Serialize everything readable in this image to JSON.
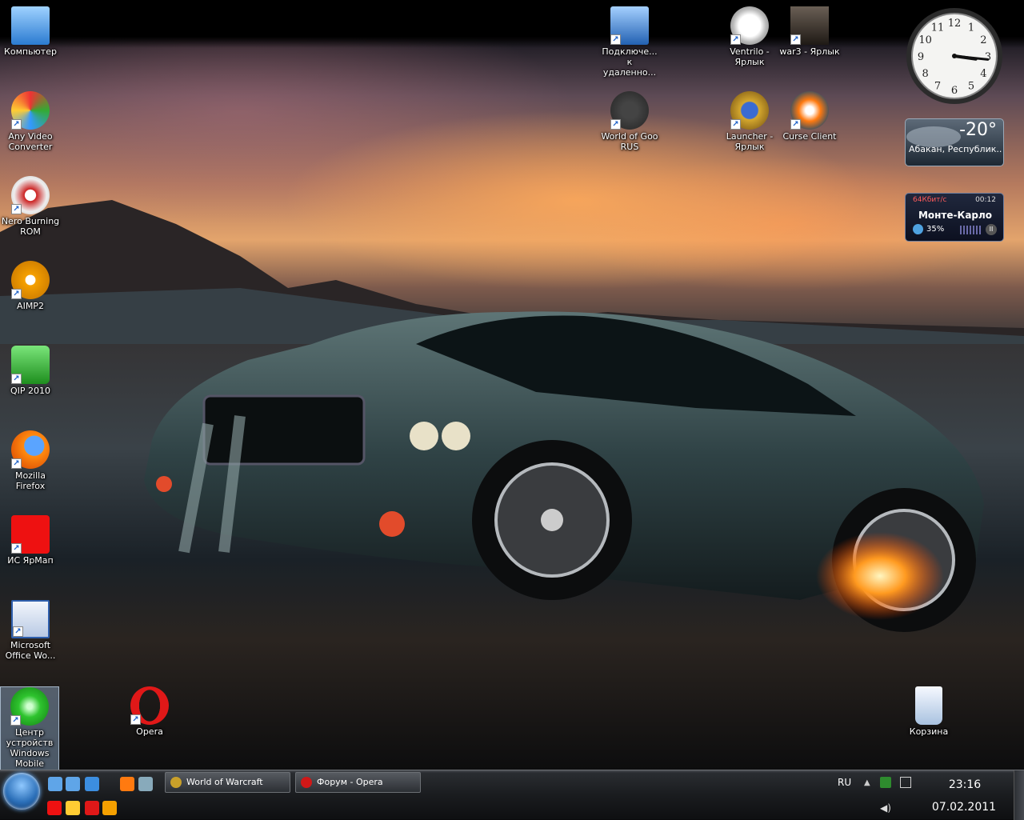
{
  "desktop": {
    "icons": [
      {
        "label": "Компьютер",
        "icon": "computer-icon"
      },
      {
        "label": "Any Video Converter",
        "icon": "video-converter-icon"
      },
      {
        "label": "Nero Burning ROM",
        "icon": "nero-icon"
      },
      {
        "label": "AIMP2",
        "icon": "aimp-icon"
      },
      {
        "label": "QIP 2010",
        "icon": "qip-icon"
      },
      {
        "label": "Mozilla Firefox",
        "icon": "firefox-icon"
      },
      {
        "label": "ИС ЯрМап",
        "icon": "yarmap-icon"
      },
      {
        "label": "Microsoft Office Wo...",
        "icon": "word-icon"
      },
      {
        "label": "Центр устройств Windows Mobile",
        "icon": "windows-mobile-icon"
      },
      {
        "label": "Opera",
        "icon": "opera-icon"
      },
      {
        "label": "Подключе... к удаленно...",
        "icon": "remote-desktop-icon"
      },
      {
        "label": "Ventrilo - Ярлык",
        "icon": "ventrilo-icon"
      },
      {
        "label": "war3 - Ярлык",
        "icon": "war3-icon"
      },
      {
        "label": "World of Goo RUS",
        "icon": "world-of-goo-icon"
      },
      {
        "label": "Launcher - Ярлык",
        "icon": "wow-launcher-icon"
      },
      {
        "label": "Curse Client",
        "icon": "curse-icon"
      },
      {
        "label": "Корзина",
        "icon": "recycle-bin-icon"
      }
    ]
  },
  "gadgets": {
    "clock": {
      "numbers": [
        "12",
        "1",
        "2",
        "3",
        "4",
        "5",
        "6",
        "7",
        "8",
        "9",
        "10",
        "11"
      ],
      "hour": 3,
      "minute": 16
    },
    "weather": {
      "temperature": "-20°",
      "location": "Абакан, Республик..."
    },
    "radio": {
      "bitrate": "64Кбит/с",
      "elapsed": "00:12",
      "station": "Монте-Карло",
      "volume": "35%"
    }
  },
  "taskbar": {
    "start_icon": "windows-start-icon",
    "quicklaunch": [
      "show-desktop-icon",
      "switch-windows-icon",
      "internet-explorer-icon",
      "firefox-icon",
      "shell-icon",
      "yarmap-icon",
      "qip-icon",
      "opera-icon",
      "messenger-icon"
    ],
    "tasks": [
      {
        "label": "World of Warcraft",
        "icon": "wow-icon",
        "color": "#c9a02a"
      },
      {
        "label": "Форум - Opera",
        "icon": "opera-icon",
        "color": "#d01818"
      }
    ],
    "tray": {
      "language": "RU",
      "time": "23:16",
      "date": "07.02.2011"
    }
  },
  "colors": {
    "accent": "#2b6fb8",
    "taskbar": "#1a1c1f"
  }
}
